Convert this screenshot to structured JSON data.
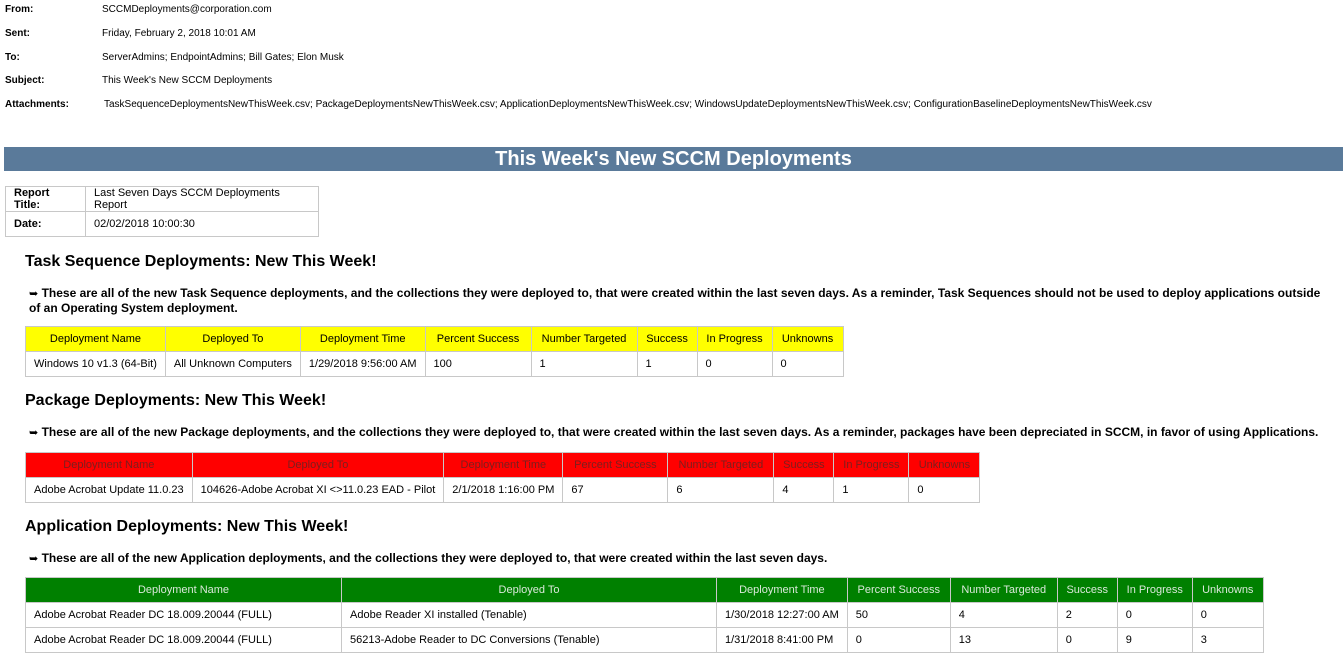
{
  "email": {
    "from_label": "From:",
    "from": "SCCMDeployments@corporation.com",
    "sent_label": "Sent:",
    "sent": "Friday, February 2, 2018 10:01 AM",
    "to_label": "To:",
    "to": "ServerAdmins; EndpointAdmins; Bill Gates; Elon Musk",
    "subject_label": "Subject:",
    "subject": "This Week's New SCCM Deployments",
    "attachments_label": "Attachments:",
    "attachments": "TaskSequenceDeploymentsNewThisWeek.csv; PackageDeploymentsNewThisWeek.csv; ApplicationDeploymentsNewThisWeek.csv; WindowsUpdateDeploymentsNewThisWeek.csv; ConfigurationBaselineDeploymentsNewThisWeek.csv"
  },
  "banner": "This Week's New SCCM Deployments",
  "report": {
    "title_label": "Report Title:",
    "title": "Last Seven Days SCCM Deployments Report",
    "date_label": "Date:",
    "date": "02/02/2018 10:00:30"
  },
  "arrow": "➥",
  "task_sequence": {
    "heading": "Task Sequence Deployments: New This Week!",
    "description": "These are all of the new Task Sequence deployments, and the collections they were deployed to, that were created within the last seven days. As a reminder, Task Sequences should not be used to deploy applications outside of an Operating System deployment.",
    "columns": [
      "Deployment Name",
      "Deployed To",
      "Deployment Time",
      "Percent Success",
      "Number Targeted",
      "Success",
      "In Progress",
      "Unknowns"
    ],
    "rows": [
      [
        "Windows 10 v1.3 (64-Bit)",
        "All Unknown Computers",
        "1/29/2018 9:56:00 AM",
        "100",
        "1",
        "1",
        "0",
        "0"
      ]
    ]
  },
  "package": {
    "heading": "Package Deployments: New This Week!",
    "description": "These are all of the new Package deployments, and the collections they were deployed to, that were created within the last seven days. As a reminder, packages have been depreciated in SCCM, in favor of using Applications.",
    "columns": [
      "Deployment Name",
      "Deployed To",
      "Deployment Time",
      "Percent Success",
      "Number Targeted",
      "Success",
      "In Progress",
      "Unknowns"
    ],
    "rows": [
      [
        "Adobe Acrobat Update 11.0.23",
        "104626-Adobe Acrobat XI <>11.0.23 EAD - Pilot",
        "2/1/2018 1:16:00 PM",
        "67",
        "6",
        "4",
        "1",
        "0"
      ]
    ]
  },
  "application": {
    "heading": "Application Deployments: New This Week!",
    "description": "These are all of the new Application deployments, and the collections they were deployed to, that were created within the last seven days.",
    "columns": [
      "Deployment Name",
      "Deployed To",
      "Deployment Time",
      "Percent Success",
      "Number Targeted",
      "Success",
      "In Progress",
      "Unknowns"
    ],
    "rows": [
      [
        "Adobe Acrobat Reader DC 18.009.20044 (FULL)",
        "Adobe Reader XI installed (Tenable)",
        "1/30/2018 12:27:00 AM",
        "50",
        "4",
        "2",
        "0",
        "0"
      ],
      [
        "Adobe Acrobat Reader DC 18.009.20044 (FULL)",
        "56213-Adobe Reader to DC Conversions (Tenable)",
        "1/31/2018 8:41:00 PM",
        "0",
        "13",
        "0",
        "9",
        "3"
      ]
    ]
  }
}
